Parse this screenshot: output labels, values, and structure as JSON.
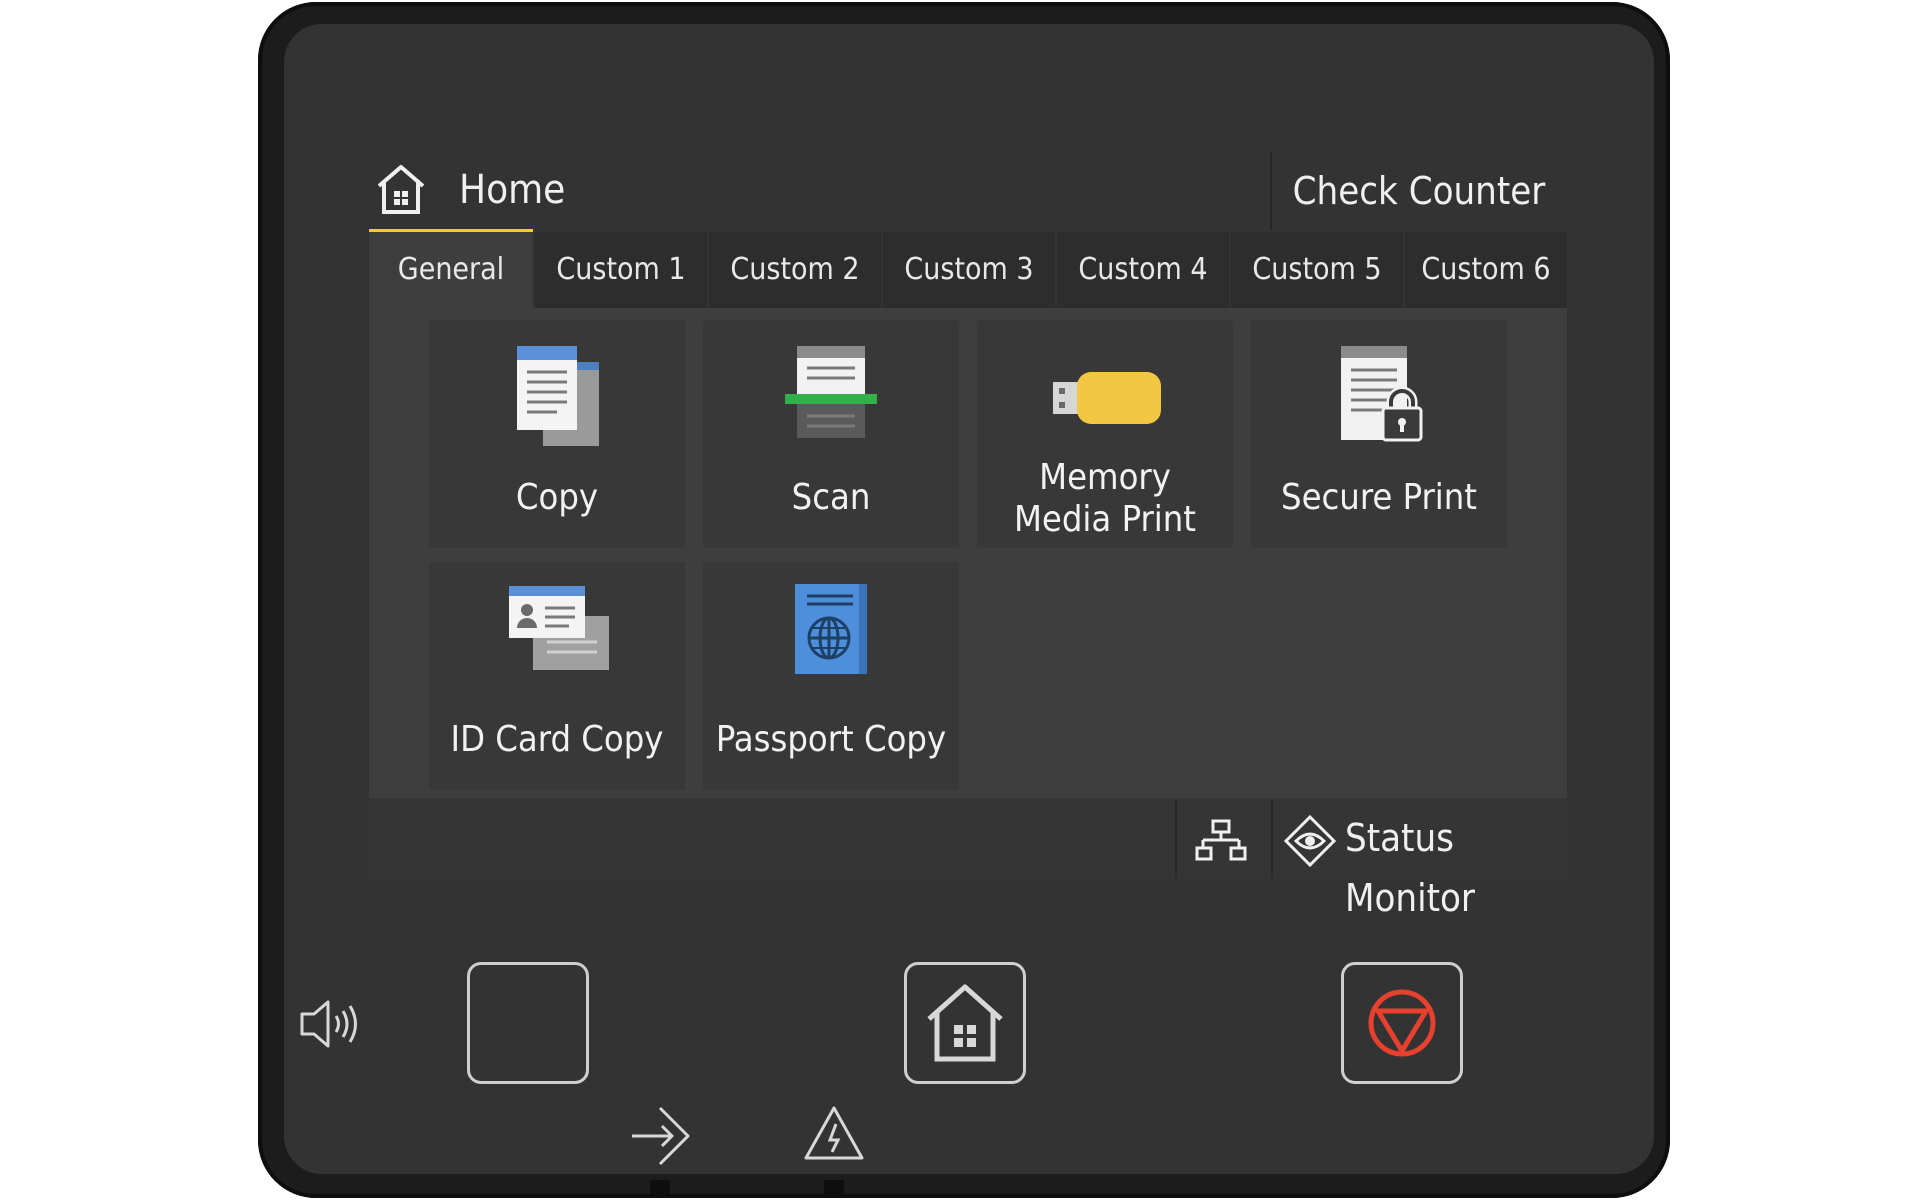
{
  "header": {
    "title": "Home",
    "home_icon": "home-icon",
    "check_counter_label": "Check Counter"
  },
  "tabs": [
    {
      "label": "General",
      "active": true
    },
    {
      "label": "Custom 1",
      "active": false
    },
    {
      "label": "Custom 2",
      "active": false
    },
    {
      "label": "Custom 3",
      "active": false
    },
    {
      "label": "Custom 4",
      "active": false
    },
    {
      "label": "Custom 5",
      "active": false
    },
    {
      "label": "Custom 6",
      "active": false
    }
  ],
  "tiles": [
    {
      "label": "Copy",
      "icon": "copy-icon"
    },
    {
      "label": "Scan",
      "icon": "scan-icon"
    },
    {
      "label_line1": "Memory",
      "label_line2": "Media Print",
      "icon": "usb-memory-icon"
    },
    {
      "label": "Secure Print",
      "icon": "secure-print-icon"
    },
    {
      "label": "ID Card Copy",
      "icon": "id-card-icon"
    },
    {
      "label": "Passport Copy",
      "icon": "passport-icon"
    }
  ],
  "footer": {
    "network_icon": "network-icon",
    "status_monitor_label": "Status Monitor",
    "status_icon": "eye-diamond-icon"
  },
  "hardware": {
    "volume_icon": "speaker-icon",
    "sleep_icon": "moon-icon",
    "home_icon": "home-icon",
    "stop_icon": "stop-icon",
    "data_icon": "arrow-in-icon",
    "error_icon": "warning-icon"
  },
  "colors": {
    "accent": "#f7d200",
    "stop": "#e8402e",
    "panel": "#3e3e3e",
    "bezel": "#333333"
  }
}
